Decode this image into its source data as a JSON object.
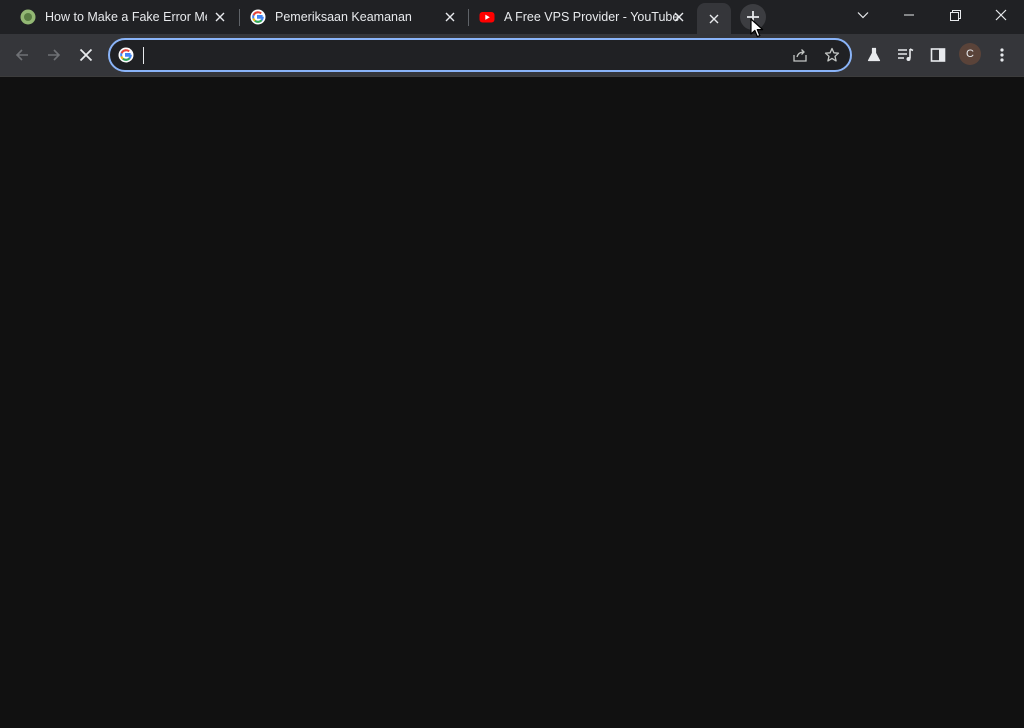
{
  "tabs": [
    {
      "title": "How to Make a Fake Error Mes",
      "favicon": "wikihow-icon"
    },
    {
      "title": "Pemeriksaan Keamanan",
      "favicon": "google-g-icon"
    },
    {
      "title": "A Free VPS Provider - YouTube",
      "favicon": "youtube-icon"
    },
    {
      "title": "",
      "favicon": "none",
      "active": true
    }
  ],
  "omnibox": {
    "value": "",
    "placeholder": ""
  },
  "profile": {
    "initial": "C"
  },
  "colors": {
    "titlebar": "#202124",
    "toolbar": "#35363a",
    "focus_ring": "#8ab4f8",
    "content_bg": "#111111"
  }
}
